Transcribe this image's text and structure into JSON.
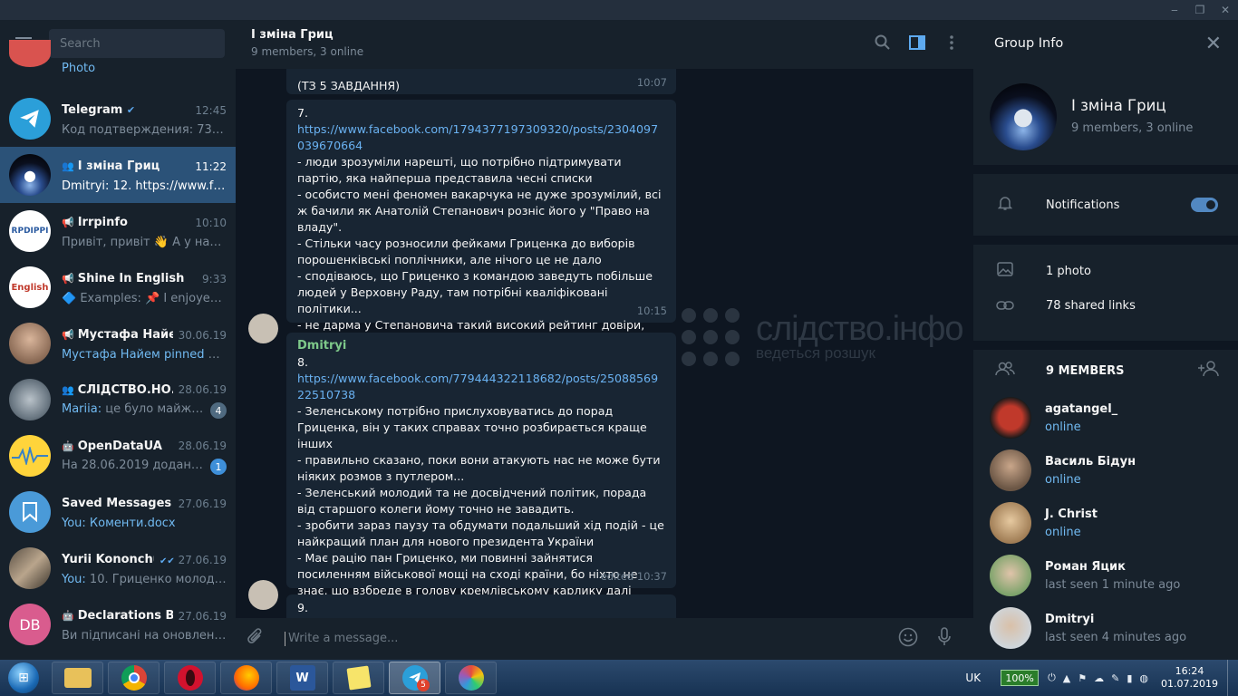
{
  "window": {
    "minimize": "‒",
    "maximize": "❐",
    "close": "✕"
  },
  "left": {
    "search_placeholder": "Search",
    "partial_top": {
      "msg": "Photo"
    },
    "chats": [
      {
        "name": "Telegram",
        "time": "12:45",
        "preview": "Код подтверждения: 73414. ...",
        "verified": "✔",
        "avatar_icon": "paper-plane-icon"
      },
      {
        "name": "І зміна Гриц",
        "time": "11:22",
        "preview": "Dmitryi: 12. https://www.face...",
        "group": true,
        "active": true
      },
      {
        "name": "Irrpinfo",
        "time": "10:10",
        "preview": "Привіт,  привіт 👋 А у нас х...",
        "channel": true,
        "avatar_text": "RPDIPPI"
      },
      {
        "name": "Shine In English",
        "time": "9:33",
        "preview": "🔷 Examples: 📌 I enjoyed ...",
        "channel": true,
        "avatar_text": "English"
      },
      {
        "name": "Мустафа Найем",
        "time": "30.06.19",
        "preview": "Мустафа Найем pinned «На...",
        "channel": true
      },
      {
        "name": "СЛІДСТВО.НО...",
        "time": "28.06.19",
        "preview_sender": "Mariia:",
        "preview": " це було майже д...",
        "group": true,
        "badge": "4"
      },
      {
        "name": "OpenDataUA",
        "time": "28.06.19",
        "preview": "На 28.06.2019 додано 2 с...",
        "bot": true,
        "badge": "1"
      },
      {
        "name": "Saved Messages",
        "time": "27.06.19",
        "preview_sender": "You:",
        "preview": " Коменти.docx"
      },
      {
        "name": "Yurii Kononchuk",
        "time": "27.06.19",
        "preview_sender": "You:",
        "preview": " 10. Гриценко молодец...",
        "read": "✔✔"
      },
      {
        "name": "Declarations Bot",
        "time": "27.06.19",
        "preview": "Ви підписані на оновлення ...",
        "bot": true,
        "avatar_text": "DB"
      }
    ]
  },
  "chat": {
    "title": "І зміна Гриц",
    "subtitle": "9 members, 3 online",
    "messages": [
      {
        "partial": "(ТЗ 5 ЗАВДАННЯ)",
        "time": "10:07"
      },
      {
        "num": "7.",
        "link": "https://www.facebook.com/1794377197309320/posts/2304097039670664",
        "lines": [
          "- люди зрозуміли нарешті, що потрібно підтримувати партію, яка найперша представила чесні списки",
          "- особисто мені феномен вакарчука не дуже зрозумілий, всі ж бачили як Анатолій Степанович розніс його у \"Право на владу\".",
          "- Стільки часу розносили фейками Гриценка до виборів порошенківські поплічники, але нічого це не дало",
          "- сподіваюсь, що Гриценко з командою заведуть побільше людей у Верховну Раду, там потрібні кваліфіковані політики...",
          "- не дарма у Степановича такий високий рейтинг довіри, українці хочуть бачити його політичну силу в парламенті"
        ],
        "time": "10:15"
      },
      {
        "sender": "Dmitryi",
        "num": "8.",
        "link": "https://www.facebook.com/779444322118682/posts/2508856922510738",
        "lines": [
          "- Зеленському потрібно прислуховуватись до порад Гриценка, він у таких справах точно розбирається краще інших",
          "- правильно сказано, поки вони атакують нас не може бути ніяких розмов з путлером...",
          "- Зеленський молодий та не досвідчений політик, порада від старшого колеги йому точно не завадить.",
          "- зробити зараз паузу та обдумати подальший хід подій - це найкращий план для нового президента України",
          "- Має рацію пан Гриценко, ми повинні зайнятися посиленням військової мощі на сході країни, бо ніхто не знає, що взбреде в голову кремлівському карлику далі"
        ],
        "time": "edited 10:37"
      },
      {
        "num": "9."
      }
    ],
    "watermark": {
      "title": "слідство.інфо",
      "subtitle": "ведеться розшук"
    },
    "composer_placeholder": "Write a message..."
  },
  "info": {
    "title": "Group Info",
    "group_name": "І зміна Гриц",
    "group_sub": "9 members, 3 online",
    "notifications_label": "Notifications",
    "notifications_on": true,
    "photos": "1 photo",
    "links": "78 shared links",
    "members_header": "9 MEMBERS",
    "members": [
      {
        "name": "agatangel_",
        "status": "online",
        "online": true
      },
      {
        "name": "Василь Бідун",
        "status": "online",
        "online": true
      },
      {
        "name": "J. Christ",
        "status": "online",
        "online": true
      },
      {
        "name": "Роман Яцик",
        "status": "last seen 1 minute ago",
        "online": false
      },
      {
        "name": "Dmitryi",
        "status": "last seen 4 minutes ago",
        "online": false
      }
    ]
  },
  "taskbar": {
    "apps": [
      "explorer",
      "chrome",
      "opera",
      "firefox",
      "word",
      "sticky-notes",
      "telegram",
      "paint"
    ],
    "telegram_badge": "5",
    "lang": "UK",
    "battery": "100%",
    "time": "16:24",
    "date": "01.07.2019"
  }
}
